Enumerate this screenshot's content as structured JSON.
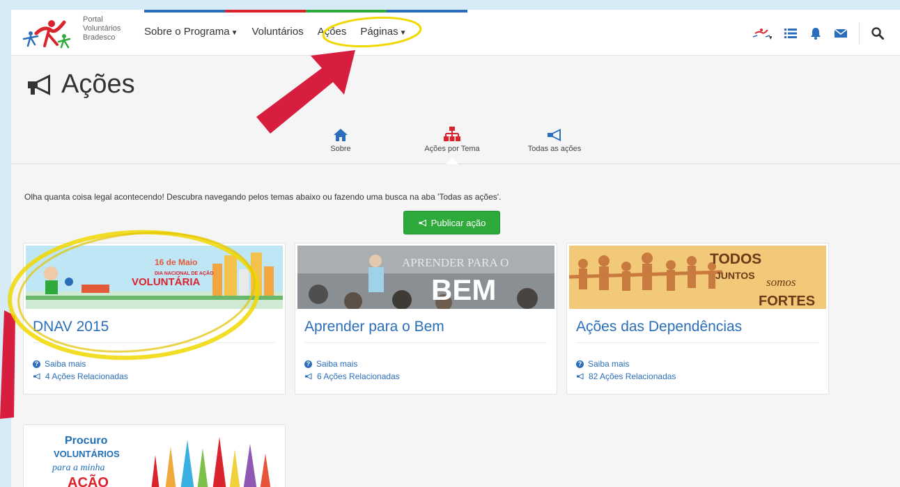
{
  "navbar": {
    "logo_text": [
      "Portal",
      "Voluntários",
      "Bradesco"
    ],
    "items": [
      {
        "label": "Sobre o Programa",
        "has_caret": true
      },
      {
        "label": "Voluntários",
        "has_caret": false
      },
      {
        "label": "Ações",
        "has_caret": false
      },
      {
        "label": "Páginas",
        "has_caret": true
      }
    ],
    "right_icons": [
      "avatar-icon",
      "list-icon",
      "bell-icon",
      "envelope-icon",
      "search-icon"
    ],
    "stripe_colors": [
      "#2a6ebb",
      "#d9232d",
      "#2eaa3c",
      "#2a6ebb"
    ]
  },
  "page": {
    "title": "Ações",
    "tabs": [
      {
        "label": "Sobre",
        "icon": "home-icon",
        "color": "#2a6ebb"
      },
      {
        "label": "Ações por Tema",
        "icon": "sitemap-icon",
        "color": "#d9232d",
        "active": true
      },
      {
        "label": "Todas as ações",
        "icon": "bullhorn-icon",
        "color": "#2a6ebb"
      }
    ],
    "intro": "Olha quanta coisa legal acontecendo! Descubra navegando pelos temas abaixo ou fazendo uma busca na aba 'Todas as ações'.",
    "publish_button": "Publicar ação"
  },
  "cards": [
    {
      "title": "DNAV 2015",
      "more": "Saiba mais",
      "related": "4 Ações Relacionadas",
      "banner": {
        "line1": "16 de Maio",
        "line2": "DIA NACIONAL DE AÇÃO",
        "line3": "VOLUNTÁRIA"
      }
    },
    {
      "title": "Aprender para o Bem",
      "more": "Saiba mais",
      "related": "6 Ações Relacionadas",
      "banner": {
        "line1": "APRENDER PARA O",
        "line2": "BEM"
      }
    },
    {
      "title": "Ações das Dependências",
      "more": "Saiba mais",
      "related": "82 Ações Relacionadas",
      "banner": {
        "line1": "TODOS",
        "line2": "JUNTOS",
        "line3": "somos",
        "line4": "FORTES"
      }
    },
    {
      "title": "",
      "banner": {
        "line1": "Procuro",
        "line2": "VOLUNTÁRIOS",
        "line3": "para a minha",
        "line4": "AÇÃO"
      }
    }
  ],
  "colors": {
    "brand_blue": "#2a6ebb",
    "brand_red": "#d9232d",
    "button_green": "#2eaa3c",
    "annotation_arrow": "#d81e3e",
    "annotation_highlight": "#f0d800"
  }
}
